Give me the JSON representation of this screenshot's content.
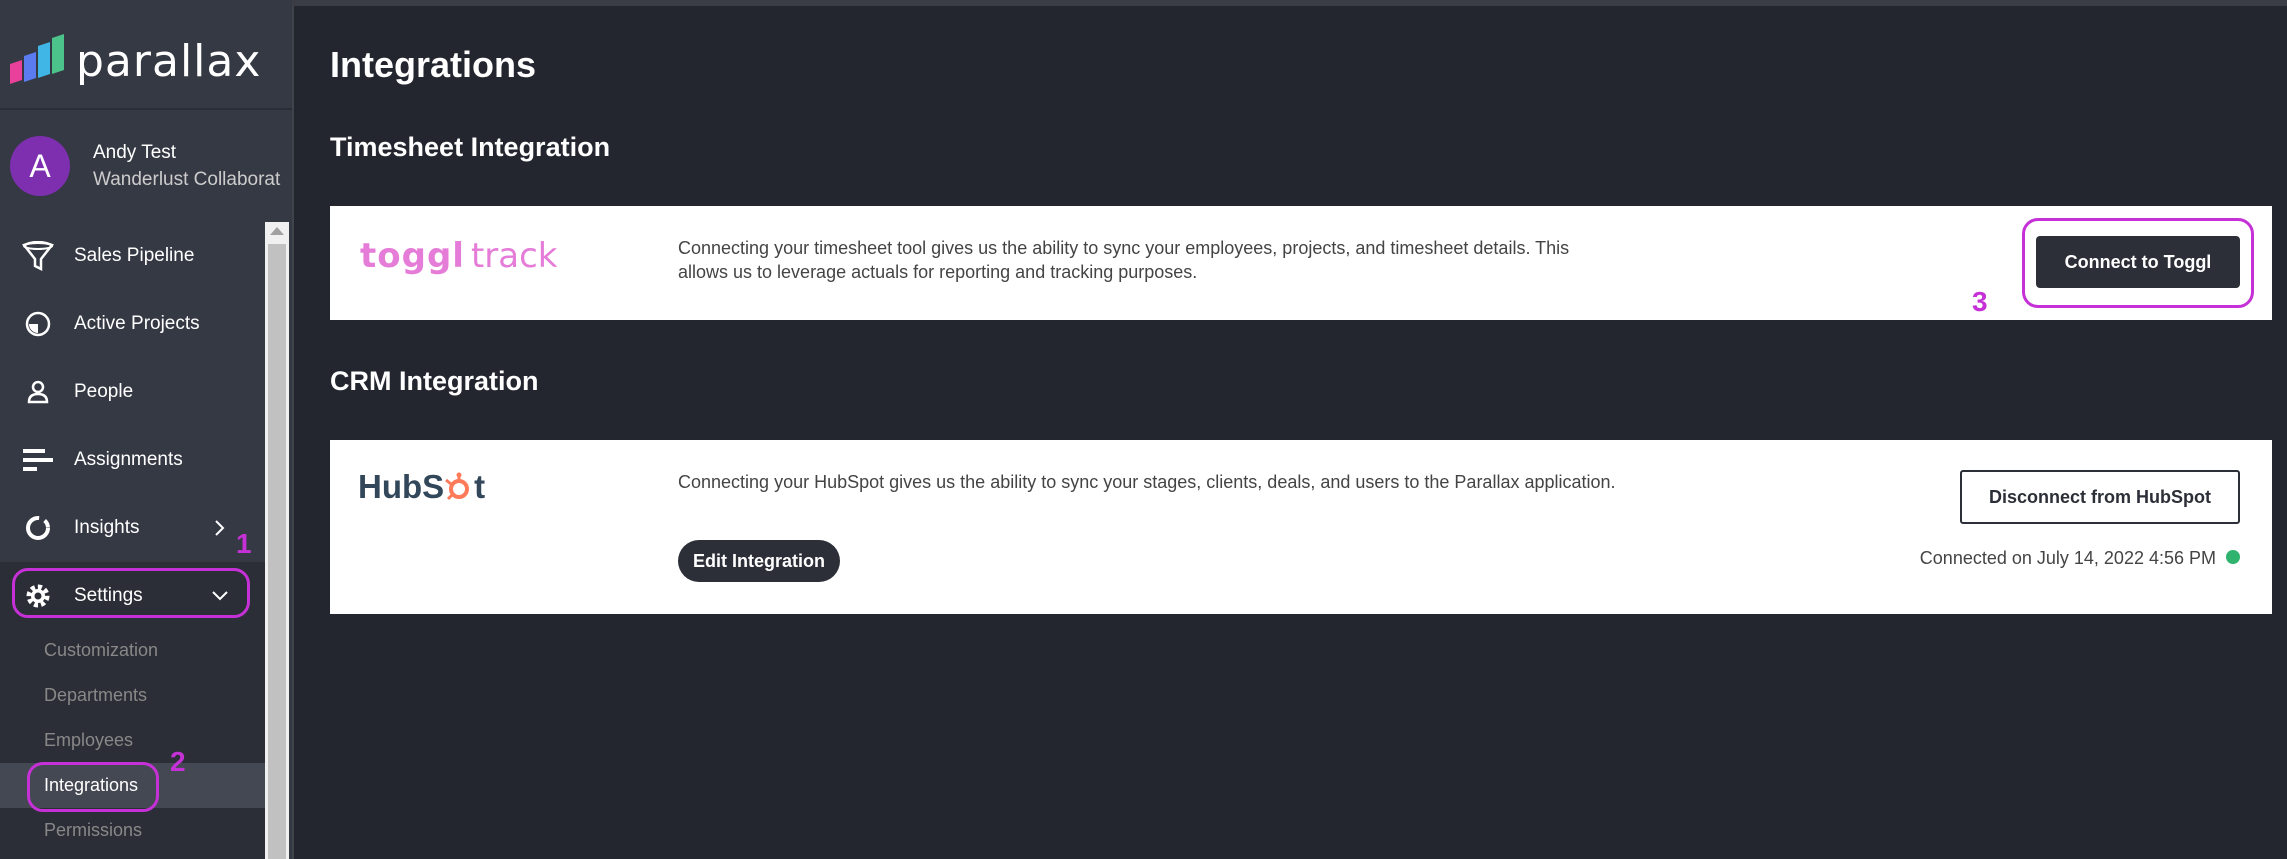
{
  "brand": {
    "name": "parallax"
  },
  "user": {
    "initial": "A",
    "name": "Andy Test",
    "org": "Wanderlust Collaborat"
  },
  "nav": {
    "items": [
      {
        "label": "Sales Pipeline",
        "icon": "funnel-icon"
      },
      {
        "label": "Active Projects",
        "icon": "pie-clock-icon"
      },
      {
        "label": "People",
        "icon": "person-icon"
      },
      {
        "label": "Assignments",
        "icon": "bars-icon"
      },
      {
        "label": "Insights",
        "icon": "ring-chart-icon"
      },
      {
        "label": "Settings",
        "icon": "gear-icon"
      }
    ],
    "settings_sub": [
      {
        "label": "Customization"
      },
      {
        "label": "Departments"
      },
      {
        "label": "Employees"
      },
      {
        "label": "Integrations",
        "active": true
      },
      {
        "label": "Permissions"
      }
    ]
  },
  "annotations": {
    "one": "1",
    "two": "2",
    "three": "3"
  },
  "page": {
    "title": "Integrations",
    "timesheet": {
      "section_title": "Timesheet Integration",
      "logo_bold": "toggl",
      "logo_light": "track",
      "description": "Connecting your timesheet tool gives us the ability to sync your employees, projects, and timesheet details. This allows us to leverage actuals for reporting and tracking purposes.",
      "button_label": "Connect to Toggl"
    },
    "crm": {
      "section_title": "CRM Integration",
      "logo_text_left": "HubS",
      "logo_text_right": "t",
      "description": "Connecting your HubSpot gives us the ability to sync your stages, clients, deals, and users to the Parallax application.",
      "edit_label": "Edit Integration",
      "disconnect_label": "Disconnect from HubSpot",
      "connected_text": "Connected on July 14, 2022 4:56 PM"
    }
  },
  "colors": {
    "accent_annotation": "#c531d6",
    "status_green": "#2fb36e",
    "toggl_pink": "#e57cd8",
    "hubspot_orange": "#ff7a59"
  }
}
